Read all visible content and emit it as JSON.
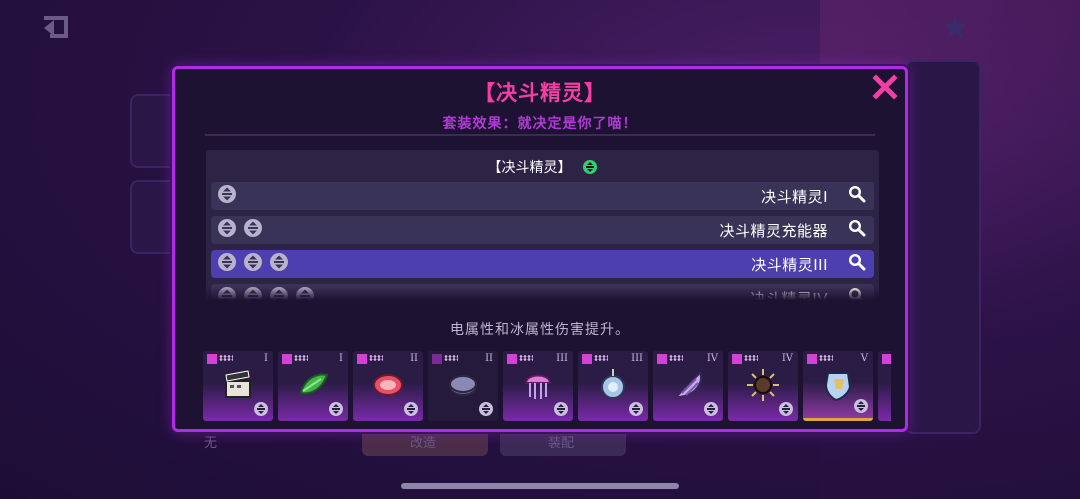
{
  "modal": {
    "title": "【决斗精灵】",
    "set_effect_label": "套装效果：就决定是你了喵！",
    "header_label": "【决斗精灵】",
    "description": "电属性和冰属性伤害提升。"
  },
  "set_items": [
    {
      "name": "决斗精灵I",
      "level_icons": 1,
      "active": false
    },
    {
      "name": "决斗精灵充能器",
      "level_icons": 2,
      "active": false
    },
    {
      "name": "决斗精灵III",
      "level_icons": 3,
      "active": true
    },
    {
      "name": "决斗精灵IV",
      "level_icons": 4,
      "active": false
    }
  ],
  "cards": [
    {
      "tier": "I",
      "icon": "clapperboard-icon",
      "style": "normal"
    },
    {
      "tier": "I",
      "icon": "leaf-icon",
      "style": "normal"
    },
    {
      "tier": "II",
      "icon": "meat-icon",
      "style": "normal"
    },
    {
      "tier": "II",
      "icon": "disc-icon",
      "style": "dim"
    },
    {
      "tier": "III",
      "icon": "jellyfish-icon",
      "style": "normal"
    },
    {
      "tier": "III",
      "icon": "amulet-icon",
      "style": "normal"
    },
    {
      "tier": "IV",
      "icon": "conch-icon",
      "style": "normal"
    },
    {
      "tier": "IV",
      "icon": "urchin-icon",
      "style": "normal"
    },
    {
      "tier": "V",
      "icon": "shield-icon",
      "style": "gold"
    }
  ],
  "background": {
    "left_label": "无",
    "bottom_btn_1": "改造",
    "bottom_btn_2": "装配"
  },
  "colors": {
    "title": "#f13fa4",
    "subtitle": "#b03ad6",
    "border": "#b02ae8",
    "active_row": "#4d3fb0",
    "level_icon_green": "#2fd16a"
  }
}
